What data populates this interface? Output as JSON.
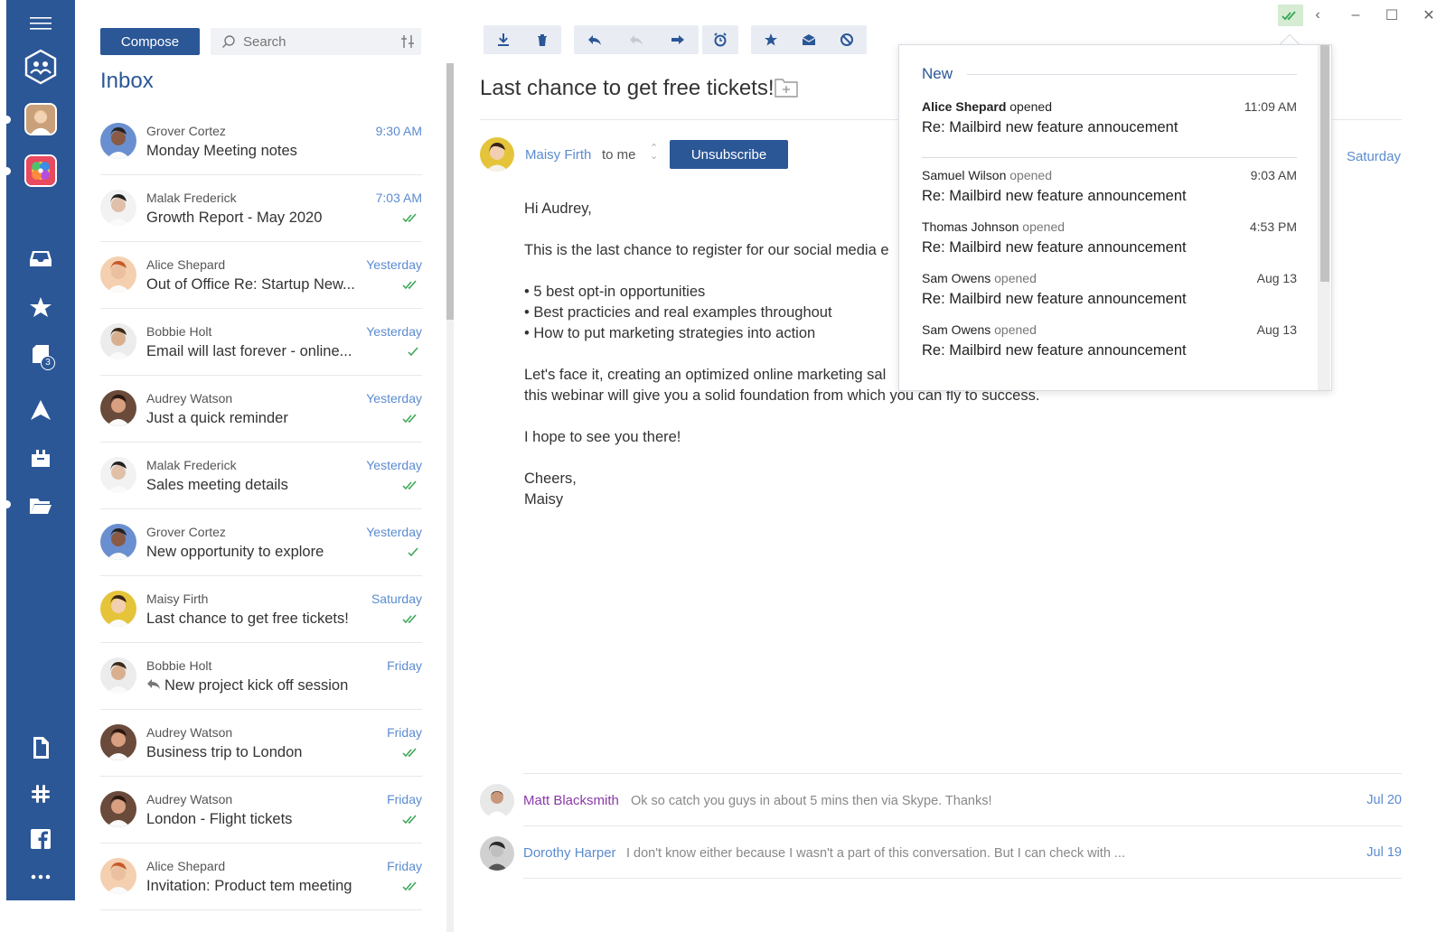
{
  "sidebar": {
    "badge_count": "3"
  },
  "list": {
    "compose_label": "Compose",
    "search_placeholder": "Search",
    "title": "Inbox",
    "items": [
      {
        "sender": "Grover Cortez",
        "subject": "Monday Meeting notes",
        "time": "9:30 AM"
      },
      {
        "sender": "Malak Frederick",
        "subject": "Growth Report - May 2020",
        "time": "7:03 AM"
      },
      {
        "sender": "Alice Shepard",
        "subject": "Out of Office Re: Startup New...",
        "time": "Yesterday"
      },
      {
        "sender": "Bobbie Holt",
        "subject": "Email will last forever - online...",
        "time": "Yesterday"
      },
      {
        "sender": "Audrey Watson",
        "subject": "Just a quick reminder",
        "time": "Yesterday"
      },
      {
        "sender": "Malak Frederick",
        "subject": "Sales meeting details",
        "time": "Yesterday"
      },
      {
        "sender": "Grover Cortez",
        "subject": "New opportunity to explore",
        "time": "Yesterday"
      },
      {
        "sender": "Maisy Firth",
        "subject": "Last chance to get free tickets!",
        "time": "Saturday"
      },
      {
        "sender": "Bobbie Holt",
        "subject": "New project kick off session",
        "time": "Friday"
      },
      {
        "sender": "Audrey Watson",
        "subject": "Business trip to London",
        "time": "Friday"
      },
      {
        "sender": "Audrey Watson",
        "subject": "London - Flight tickets",
        "time": "Friday"
      },
      {
        "sender": "Alice Shepard",
        "subject": "Invitation: Product tem meeting",
        "time": "Friday"
      }
    ]
  },
  "message": {
    "subject": "Last chance to get free tickets!",
    "from": "Maisy Firth",
    "to": "to me",
    "unsubscribe_label": "Unsubscribe",
    "date": "Saturday",
    "greeting": "Hi Audrey,",
    "intro": "This is the last chance to register for our social media e",
    "bullets": [
      "5 best opt-in opportunities",
      "Best practicies and real examples throughout",
      "How to put marketing strategies into action"
    ],
    "para_line1": "Let's face it, creating an optimized online marketing sal",
    "para_line2": "this webinar will give you a solid foundation from which you can fly to success.",
    "closing": "I hope to see you there!",
    "signoff": "Cheers,",
    "signature": "Maisy"
  },
  "thread": [
    {
      "name": "Matt Blacksmith",
      "snippet": "Ok so catch you guys in about 5 mins then via Skype. Thanks!",
      "date": "Jul 20",
      "color": "#8b3aa8"
    },
    {
      "name": "Dorothy Harper",
      "snippet": "I don't know either because I wasn't a part of this conversation. But I can check with ...",
      "date": "Jul 19",
      "color": "#5b8bd0"
    }
  ],
  "popup": {
    "heading": "New",
    "first": {
      "name": "Alice Shepard",
      "action": "opened",
      "time": "11:09 AM",
      "subject": "Re: Mailbird new feature annoucement"
    },
    "items": [
      {
        "name": "Samuel Wilson",
        "action": "opened",
        "time": "9:03 AM",
        "subject": "Re: Mailbird new feature announcement"
      },
      {
        "name": "Thomas Johnson",
        "action": "opened",
        "time": "4:53 PM",
        "subject": "Re: Mailbird new feature announcement"
      },
      {
        "name": "Sam Owens",
        "action": "opened",
        "time": "Aug 13",
        "subject": "Re: Mailbird new feature announcement"
      },
      {
        "name": "Sam Owens",
        "action": "opened",
        "time": "Aug 13",
        "subject": "Re: Mailbird new feature announcement"
      }
    ]
  },
  "colors": {
    "brand": "#2b5797",
    "link": "#5b8bd0",
    "check": "#3aa655"
  }
}
